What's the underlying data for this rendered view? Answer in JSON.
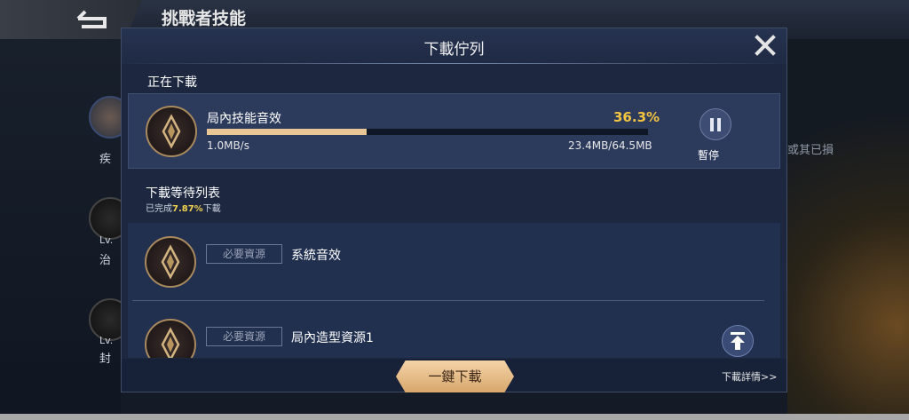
{
  "background": {
    "title": "挑戰者技能",
    "heroes": [
      {
        "label": "疾",
        "level": ""
      },
      {
        "label": "治",
        "level": "Lv."
      },
      {
        "label": "封",
        "level": "Lv."
      }
    ],
    "right_text": "或其已損"
  },
  "dialog": {
    "title": "下載佇列",
    "current_section_label": "正在下載",
    "current_item": {
      "name": "局內技能音效",
      "percent_text": "36.3%",
      "progress": 0.363,
      "speed": "1.0MB/s",
      "size": "23.4MB/64.5MB",
      "pause_label": "暫停"
    },
    "queue_section_label": "下載等待列表",
    "queue_summary": {
      "prefix": "已完成",
      "percent": "7.87%",
      "suffix": "下載"
    },
    "queue_items": [
      {
        "tag": "必要資源",
        "name": "系統音效"
      },
      {
        "tag": "必要資源",
        "name": "局內造型資源1"
      }
    ],
    "download_all_label": "一鍵下載",
    "details_label": "下載詳情>>"
  },
  "colors": {
    "accent_gold": "#f2c440",
    "progress_fill": "#e8c696",
    "dialog_bg": "#1d2840"
  }
}
